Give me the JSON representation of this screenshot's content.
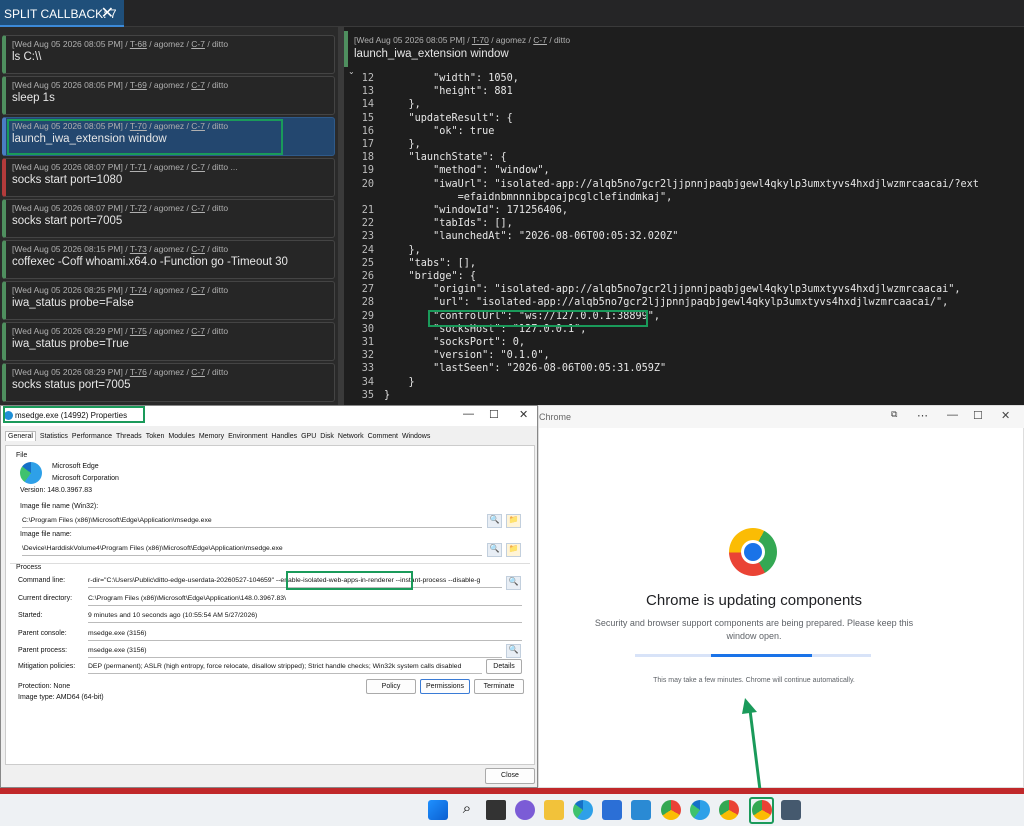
{
  "tab": {
    "label": "SPLIT CALLBACK: 7",
    "close": "✕"
  },
  "callbacks": [
    {
      "meta_date": "[Wed Aug 05 2026 08:05 PM] / ",
      "meta_task": "T-68",
      "meta_user": " / agomez / ",
      "meta_cb": "C-7",
      "meta_op": " / ditto",
      "command": "ls C:\\\\",
      "status": "success"
    },
    {
      "meta_date": "[Wed Aug 05 2026 08:05 PM] / ",
      "meta_task": "T-69",
      "meta_user": " / agomez / ",
      "meta_cb": "C-7",
      "meta_op": " / ditto",
      "command": "sleep 1s",
      "status": "success"
    },
    {
      "meta_date": "[Wed Aug 05 2026 08:05 PM] / ",
      "meta_task": "T-70",
      "meta_user": " / agomez / ",
      "meta_cb": "C-7",
      "meta_op": " / ditto",
      "command": "launch_iwa_extension window",
      "status": "selected"
    },
    {
      "meta_date": "[Wed Aug 05 2026 08:07 PM] / ",
      "meta_task": "T-71",
      "meta_user": " / agomez / ",
      "meta_cb": "C-7",
      "meta_op": " / ditto ...",
      "command": "socks start port=1080",
      "status": "error"
    },
    {
      "meta_date": "[Wed Aug 05 2026 08:07 PM] / ",
      "meta_task": "T-72",
      "meta_user": " / agomez / ",
      "meta_cb": "C-7",
      "meta_op": " / ditto",
      "command": "socks start port=7005",
      "status": "success"
    },
    {
      "meta_date": "[Wed Aug 05 2026 08:15 PM] / ",
      "meta_task": "T-73",
      "meta_user": " / agomez / ",
      "meta_cb": "C-7",
      "meta_op": " / ditto",
      "command": "coffexec -Coff whoami.x64.o -Function go -Timeout 30",
      "status": "success"
    },
    {
      "meta_date": "[Wed Aug 05 2026 08:25 PM] / ",
      "meta_task": "T-74",
      "meta_user": " / agomez / ",
      "meta_cb": "C-7",
      "meta_op": " / ditto",
      "command": "iwa_status probe=False",
      "status": "success"
    },
    {
      "meta_date": "[Wed Aug 05 2026 08:29 PM] / ",
      "meta_task": "T-75",
      "meta_user": " / agomez / ",
      "meta_cb": "C-7",
      "meta_op": " / ditto",
      "command": "iwa_status probe=True",
      "status": "success"
    },
    {
      "meta_date": "[Wed Aug 05 2026 08:29 PM] / ",
      "meta_task": "T-76",
      "meta_user": " / agomez / ",
      "meta_cb": "C-7",
      "meta_op": " / ditto",
      "command": "socks status port=7005",
      "status": "success"
    }
  ],
  "output": {
    "meta_date": "[Wed Aug 05 2026 08:05 PM] / ",
    "meta_task": "T-70",
    "meta_user": " / agomez / ",
    "meta_cb": "C-7",
    "meta_op": " / ditto",
    "command": "launch_iwa_extension window",
    "lines": [
      {
        "n": "12",
        "t": "        \"width\": 1050,"
      },
      {
        "n": "13",
        "t": "        \"height\": 881"
      },
      {
        "n": "14",
        "t": "    },"
      },
      {
        "n": "15",
        "t": "    \"updateResult\": {"
      },
      {
        "n": "16",
        "t": "        \"ok\": true"
      },
      {
        "n": "17",
        "t": "    },"
      },
      {
        "n": "18",
        "t": "    \"launchState\": {"
      },
      {
        "n": "19",
        "t": "        \"method\": \"window\","
      },
      {
        "n": "20",
        "t": "        \"iwaUrl\": \"isolated-app://alqb5no7gcr2ljjpnnjpaqbjgewl4qkylp3umxtyvs4hxdjlwzmrcaacai/?ext"
      },
      {
        "n": "",
        "t": "            =efaidnbmnnnibpcajpcglclefindmkaj\","
      },
      {
        "n": "21",
        "t": "        \"windowId\": 171256406,"
      },
      {
        "n": "22",
        "t": "        \"tabIds\": [],"
      },
      {
        "n": "23",
        "t": "        \"launchedAt\": \"2026-08-06T00:05:32.020Z\""
      },
      {
        "n": "24",
        "t": "    },"
      },
      {
        "n": "25",
        "t": "    \"tabs\": [],"
      },
      {
        "n": "26",
        "t": "    \"bridge\": {"
      },
      {
        "n": "27",
        "t": "        \"origin\": \"isolated-app://alqb5no7gcr2ljjpnnjpaqbjgewl4qkylp3umxtyvs4hxdjlwzmrcaacai\","
      },
      {
        "n": "28",
        "t": "        \"url\": \"isolated-app://alqb5no7gcr2ljjpnnjpaqbjgewl4qkylp3umxtyvs4hxdjlwzmrcaacai/\","
      },
      {
        "n": "29",
        "t": "        \"controlUrl\": \"ws://127.0.0.1:38899\","
      },
      {
        "n": "30",
        "t": "        \"socksHost\": \"127.0.0.1\","
      },
      {
        "n": "31",
        "t": "        \"socksPort\": 0,"
      },
      {
        "n": "32",
        "t": "        \"version\": \"0.1.0\","
      },
      {
        "n": "33",
        "t": "        \"lastSeen\": \"2026-08-06T00:05:31.059Z\""
      },
      {
        "n": "34",
        "t": "    }"
      },
      {
        "n": "35",
        "t": "}"
      }
    ]
  },
  "props": {
    "title": "msedge.exe (14992) Properties",
    "tabs": [
      "General",
      "Statistics",
      "Performance",
      "Threads",
      "Token",
      "Modules",
      "Memory",
      "Environment",
      "Handles",
      "GPU",
      "Disk",
      "Network",
      "Comment",
      "Windows"
    ],
    "file_label": "File",
    "product": "Microsoft Edge",
    "company": "Microsoft Corporation",
    "version": "Version:  148.0.3967.83",
    "image_name_label": "Image file name (Win32):",
    "image_name": "C:\\Program Files (x86)\\Microsoft\\Edge\\Application\\msedge.exe",
    "image_file_label": "Image file name:",
    "image_file": "\\Device\\HarddiskVolume4\\Program Files (x86)\\Microsoft\\Edge\\Application\\msedge.exe",
    "process_label": "Process",
    "cmdline_label": "Command line:",
    "cmdline_a": "r-dir=\"C:\\Users\\Public\\ditto-edge-userdata-20260527-104659\" ",
    "cmdline_b": "--enable-isolated-web-apps-in-renderer",
    "cmdline_c": " --instant-process --disable-g",
    "curdir_label": "Current directory:",
    "curdir": "C:\\Program Files (x86)\\Microsoft\\Edge\\Application\\148.0.3967.83\\",
    "started_label": "Started:",
    "started": "9 minutes and 10 seconds ago (10:55:54 AM 5/27/2026)",
    "parent_console_label": "Parent console:",
    "parent_console": "msedge.exe (3156)",
    "parent_process_label": "Parent process:",
    "parent_process": "msedge.exe (3156)",
    "mitigation_label": "Mitigation policies:",
    "mitigation": "DEP (permanent); ASLR (high entropy, force relocate, disallow stripped); Strict handle checks; Win32k system calls disabled",
    "details": "Details",
    "protection": "Protection:   None",
    "image_type": "Image type:  AMD64 (64-bit)",
    "policy": "Policy",
    "permissions": "Permissions",
    "terminate": "Terminate",
    "close": "Close"
  },
  "chrome": {
    "title": "Chrome",
    "heading": "Chrome is updating components",
    "body": "Security and browser support components are being prepared. Please keep this window open.",
    "note": "This may take a few minutes. Chrome will continue automatically.",
    "progress": 0.43
  },
  "colors": {
    "accent": "#1a9a5a",
    "brand": "#1a73e8",
    "error": "#b23b3b",
    "selected": "#23476f"
  }
}
